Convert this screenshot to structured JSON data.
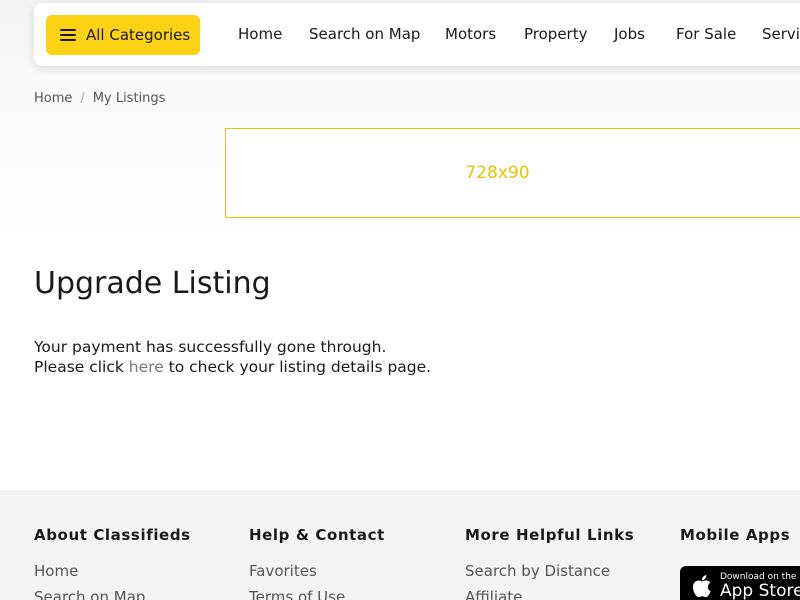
{
  "header": {
    "categories_button": "All Categories",
    "nav": [
      "Home",
      "Search on Map",
      "Motors",
      "Property",
      "Jobs",
      "For Sale",
      "Services"
    ]
  },
  "breadcrumb": [
    "Home",
    "My Listings"
  ],
  "ad": {
    "label": "728x90",
    "border_color": "#f2c200"
  },
  "main": {
    "title": "Upgrade Listing",
    "line1": "Your payment has successfully gone through.",
    "line2_prefix": "Please click ",
    "line2_link": "here",
    "line2_suffix": " to check your listing details page."
  },
  "footer": {
    "columns": [
      {
        "heading": "About Classifieds",
        "links": [
          "Home",
          "Search on Map"
        ]
      },
      {
        "heading": "Help & Contact",
        "links": [
          "Favorites",
          "Terms of Use"
        ]
      },
      {
        "heading": "More Helpful Links",
        "links": [
          "Search by Distance",
          "Affiliate"
        ]
      },
      {
        "heading": "Mobile Apps",
        "links": []
      }
    ],
    "app_store": {
      "small": "Download on the",
      "big": "App Store",
      "icon": "apple-icon"
    }
  },
  "colors": {
    "accent": "#fdd215",
    "footer_bg": "#f4f4f4"
  }
}
